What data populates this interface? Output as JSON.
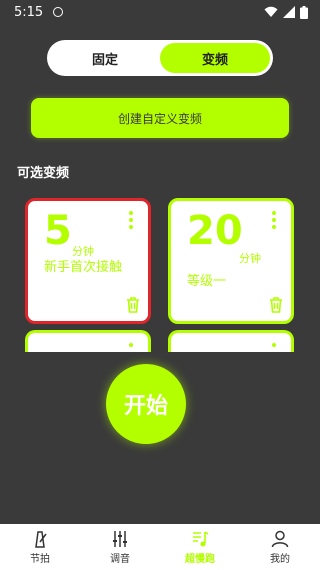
{
  "status_bar": {
    "time": "5:15"
  },
  "mode_toggle": {
    "fixed_label": "固定",
    "variable_label": "变频",
    "selected": "变频"
  },
  "create_button": {
    "label": "创建自定义变频"
  },
  "section": {
    "title": "可选变频"
  },
  "cards": [
    {
      "minutes": "5",
      "unit": "分钟",
      "name": "新手首次接触",
      "selected": true
    },
    {
      "minutes": "20",
      "unit": "分钟",
      "name": "等级一",
      "selected": false
    }
  ],
  "start_button": {
    "label": "开始"
  },
  "bottom_nav": {
    "items": [
      {
        "label": "节拍",
        "icon": "metronome-icon",
        "active": false
      },
      {
        "label": "调音",
        "icon": "mixer-sliders-icon",
        "active": false
      },
      {
        "label": "超慢跑",
        "icon": "music-note-icon",
        "active": true
      },
      {
        "label": "我的",
        "icon": "person-icon",
        "active": false
      }
    ]
  },
  "colors": {
    "accent": "#b3ff00",
    "background": "#3a3a3a",
    "selected_border": "#e0262a"
  }
}
